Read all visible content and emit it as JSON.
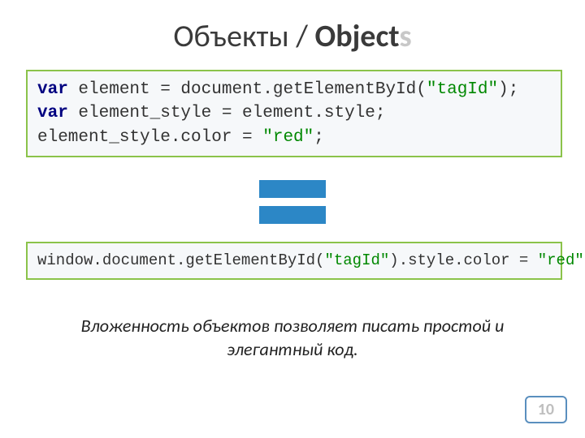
{
  "title": {
    "prefix": "Объекты / ",
    "bold": "Object",
    "faded": "s"
  },
  "code1": {
    "lines": [
      {
        "tokens": [
          {
            "t": "var",
            "c": "kw-dark"
          },
          {
            "t": " element = document.getElementById(",
            "c": "ident"
          },
          {
            "t": "\"tagId\"",
            "c": "str"
          },
          {
            "t": ");",
            "c": "ident"
          }
        ]
      },
      {
        "tokens": [
          {
            "t": "var",
            "c": "kw-dark"
          },
          {
            "t": " element_style = element.style;",
            "c": "ident"
          }
        ]
      },
      {
        "tokens": [
          {
            "t": "element_style.color = ",
            "c": "ident"
          },
          {
            "t": "\"red\"",
            "c": "str"
          },
          {
            "t": ";",
            "c": "ident"
          }
        ]
      }
    ]
  },
  "code2": {
    "lines": [
      {
        "tokens": [
          {
            "t": "window.document.getElementById(",
            "c": "ident"
          },
          {
            "t": "\"tagId\"",
            "c": "str"
          },
          {
            "t": ").style.color = ",
            "c": "ident"
          },
          {
            "t": "\"red\"",
            "c": "str"
          },
          {
            "t": ";",
            "c": "ident"
          }
        ]
      }
    ]
  },
  "footer": "Вложенность объектов позволяет писать простой и элегантный код.",
  "page_number": "10"
}
